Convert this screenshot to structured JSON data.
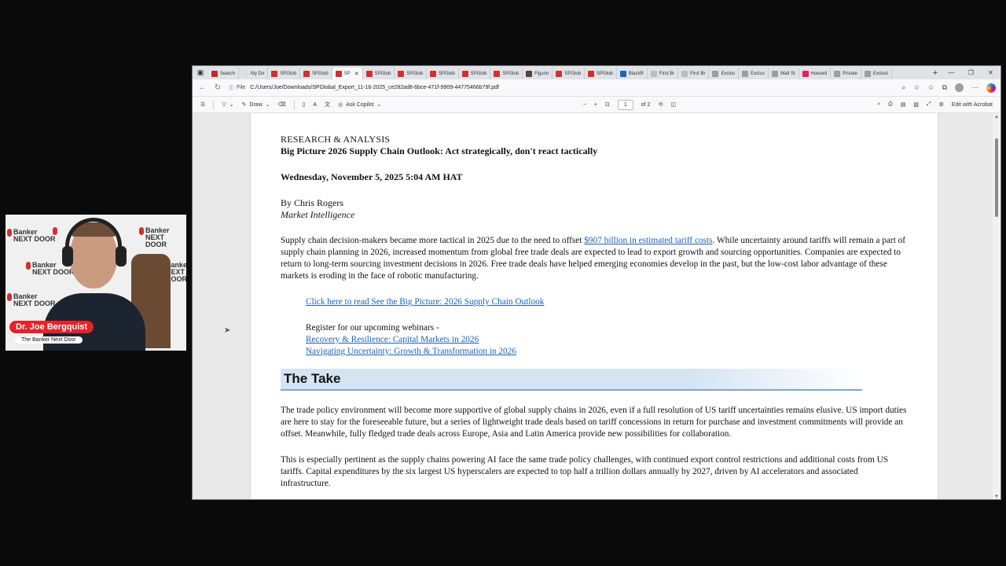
{
  "browser": {
    "tabs": [
      {
        "label": "Search",
        "color": "#c62828"
      },
      {
        "label": "My Do",
        "color": "#dddddd"
      },
      {
        "label": "SPGlob",
        "color": "#d32f2f"
      },
      {
        "label": "SPGlob",
        "color": "#d32f2f"
      },
      {
        "label": "SP",
        "color": "#d32f2f",
        "active": true
      },
      {
        "label": "SPGlob",
        "color": "#d32f2f"
      },
      {
        "label": "SPGlob",
        "color": "#d32f2f"
      },
      {
        "label": "SPGlob",
        "color": "#d32f2f"
      },
      {
        "label": "SPGlob",
        "color": "#d32f2f"
      },
      {
        "label": "SPGlob",
        "color": "#d32f2f"
      },
      {
        "label": "Figurin",
        "color": "#5d4037"
      },
      {
        "label": "SPGlob",
        "color": "#d32f2f"
      },
      {
        "label": "SPGlob",
        "color": "#d32f2f"
      },
      {
        "label": "BlackR",
        "color": "#1565c0"
      },
      {
        "label": "First Br",
        "color": "#bdbdbd"
      },
      {
        "label": "First Br",
        "color": "#bdbdbd"
      },
      {
        "label": "Exclus",
        "color": "#9e9e9e"
      },
      {
        "label": "Exclus",
        "color": "#9e9e9e"
      },
      {
        "label": "Wall St",
        "color": "#9e9e9e"
      },
      {
        "label": "Howard",
        "color": "#e91e63"
      },
      {
        "label": "Private",
        "color": "#9e9e9e"
      },
      {
        "label": "Exclusi",
        "color": "#9e9e9e"
      }
    ],
    "address": {
      "scheme_label": "File",
      "url": "C:/Users/Joe/Downloads/SPGlobal_Export_11-16-2025_ce282ad8-6bce-471f-9909-44775466b79f.pdf"
    },
    "toolbar": {
      "draw_label": "Draw",
      "ask_copilot_label": "Ask Copilot",
      "page_number": "1",
      "page_total": "of 2",
      "edit_label": "Edit with Acrobat"
    }
  },
  "document": {
    "section": "RESEARCH & ANALYSIS",
    "title": "Big Picture 2026 Supply Chain Outlook: Act strategically, don't react tactically",
    "date": "Wednesday, November 5, 2025 5:04 AM HAT",
    "author": "By Chris Rogers",
    "team": "Market Intelligence",
    "intro_pre": "Supply chain decision-makers became more tactical in 2025 due to the need to offset ",
    "intro_link": "$907 billion in estimated tariff costs",
    "intro_post": ". While uncertainty around tariffs will remain a part of supply chain planning in 2026, increased momentum from global free trade deals are expected to lead to export growth and sourcing opportunities. Companies are expected to return to long-term sourcing investment decisions in 2026. Free trade deals have helped emerging economies develop in the past, but the low-cost labor advantage of these markets is eroding in the face of robotic manufacturing.",
    "read_link": "Click here to read See the Big Picture: 2026 Supply Chain Outlook",
    "register_text": "Register for our upcoming webinars -",
    "webinar1": "Recovery & Resilience: Capital Markets in 2026",
    "webinar2": "Navigating Uncertainty: Growth & Transformation in 2026",
    "take_heading": "The Take",
    "para1": "The trade policy environment will become more supportive of global supply chains in 2026, even if a full resolution of US tariff uncertainties remains elusive. US import duties are here to stay for the foreseeable future, but a series of lightweight trade deals based on tariff concessions in return for purchase and investment commitments will provide an offset. Meanwhile, fully fledged trade deals across Europe, Asia and Latin America provide new possibilities for collaboration.",
    "para2": "This is especially pertinent as the supply chains powering AI face the same trade policy challenges, with continued export control restrictions and additional costs from US tariffs. Capital expenditures by the six largest US hyperscalers are expected to top half a trillion dollars annually by 2027, driven by AI accelerators and associated infrastructure."
  },
  "webcam": {
    "name": "Dr. Joe Bergquist",
    "show": "The Banker Next Door",
    "wall_logo_line1": "Banker",
    "wall_logo_line2": "NEXT DOOR"
  }
}
